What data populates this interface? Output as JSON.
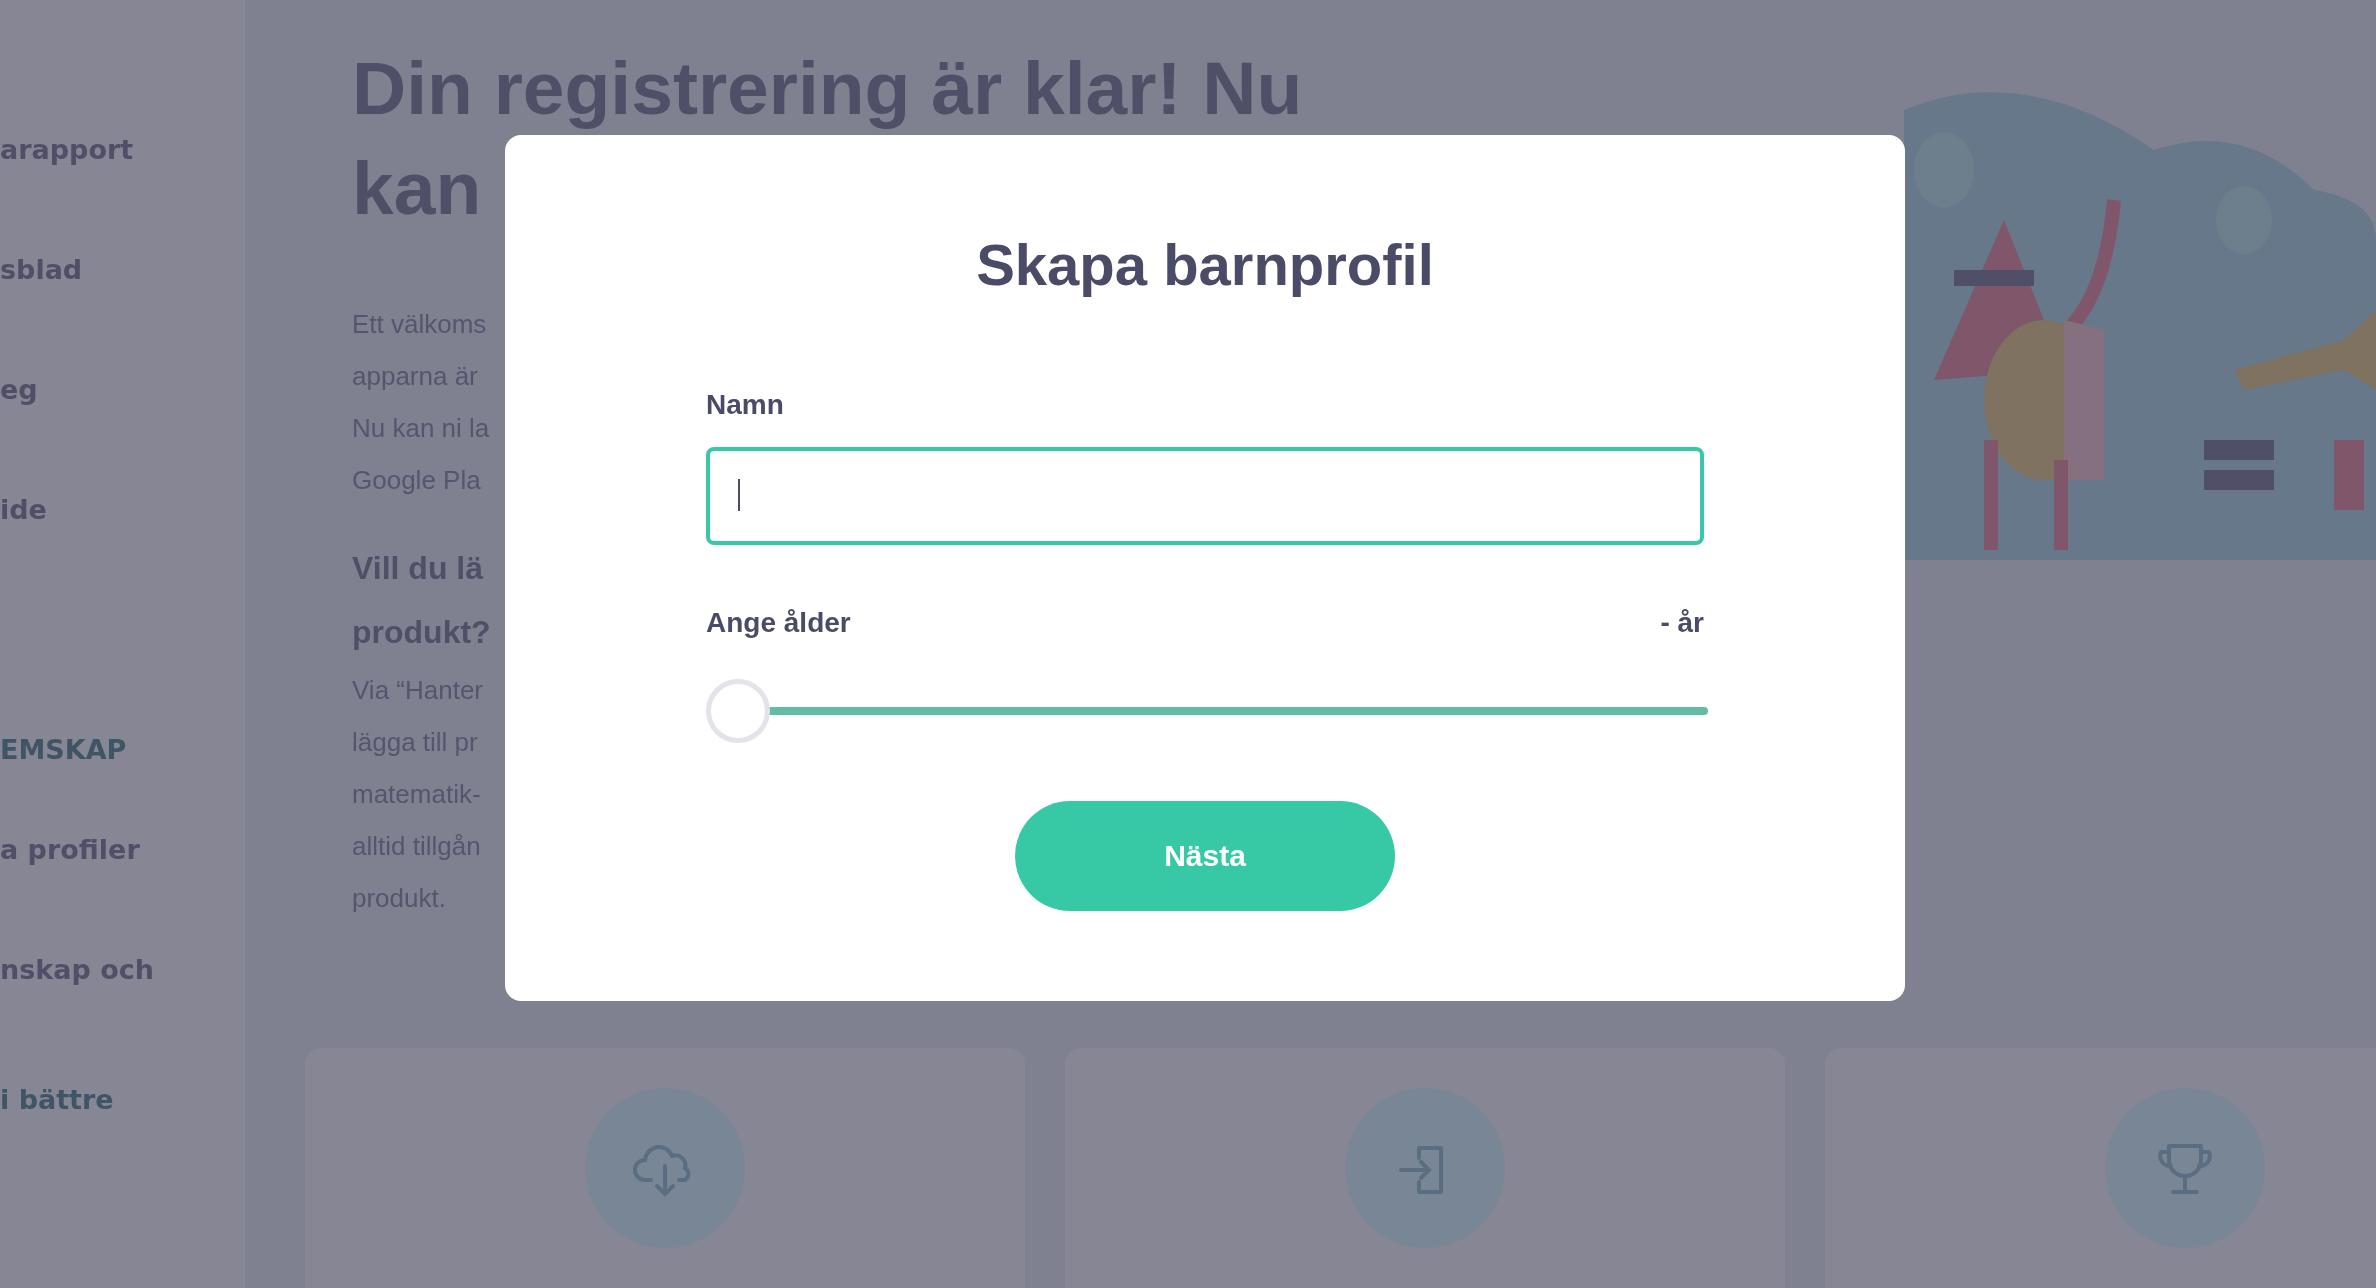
{
  "sidebar": {
    "items": [
      {
        "label": "arapport",
        "kind": "link"
      },
      {
        "label": "sblad",
        "kind": "link"
      },
      {
        "label": "eg",
        "kind": "link"
      },
      {
        "label": "ide",
        "kind": "link"
      },
      {
        "label": "EMSKAP",
        "kind": "section"
      },
      {
        "label": "a profiler",
        "kind": "link"
      },
      {
        "label": "nskap och",
        "kind": "link"
      },
      {
        "label": "i bättre",
        "kind": "accent"
      }
    ]
  },
  "page": {
    "heading": [
      "Din registrering är klar! Nu",
      "kan"
    ],
    "paragraph_1": [
      "Ett välkoms",
      "apparna är",
      "Nu kan ni la",
      "Google Pla"
    ],
    "subheading": [
      "Vill du lä",
      "produkt?"
    ],
    "paragraph_2": [
      "Via “Hanter",
      "lägga till pr",
      "matematik-",
      "alltid tillgån",
      "produkt."
    ]
  },
  "cards": [
    {
      "kind": "download"
    },
    {
      "kind": "login"
    },
    {
      "kind": "trophy"
    }
  ],
  "dialog": {
    "title": "Skapa barnprofil",
    "name_label": "Namn",
    "name_field": {
      "focused": true
    },
    "age_label": "Ange ålder",
    "age_reading": "- år",
    "age_slider": {
      "level": 0
    },
    "button": "Nästa"
  }
}
